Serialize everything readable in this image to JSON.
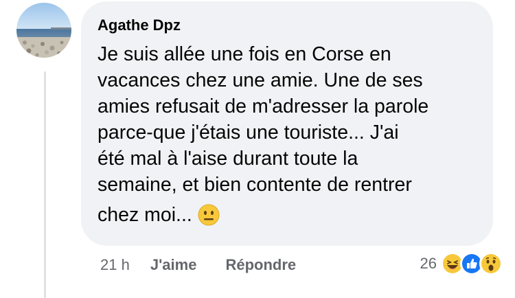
{
  "comment": {
    "author": "Agathe Dpz",
    "text_lines": [
      "Je suis allée une fois en Corse en",
      "vacances chez une amie. Une de ses",
      "amies refusait de m'adresser la parole",
      "parce-que j'étais une touriste... J'ai",
      "été mal à l'aise durant toute la",
      "semaine, et bien contente de rentrer",
      "chez moi..."
    ],
    "inline_emoji": "neutral-face-icon",
    "avatar_icon": "beach-photo-avatar"
  },
  "actions": {
    "timestamp": "21 h",
    "like_label": "J'aime",
    "reply_label": "Répondre"
  },
  "reactions": {
    "count": "26",
    "icons": [
      "haha-reaction-icon",
      "like-reaction-icon",
      "wow-reaction-icon"
    ]
  },
  "colors": {
    "bubble_bg": "#f0f2f5",
    "meta_text": "#65676b",
    "like_blue": "#1877f2",
    "emoji_yellow": "#f7c83a"
  }
}
